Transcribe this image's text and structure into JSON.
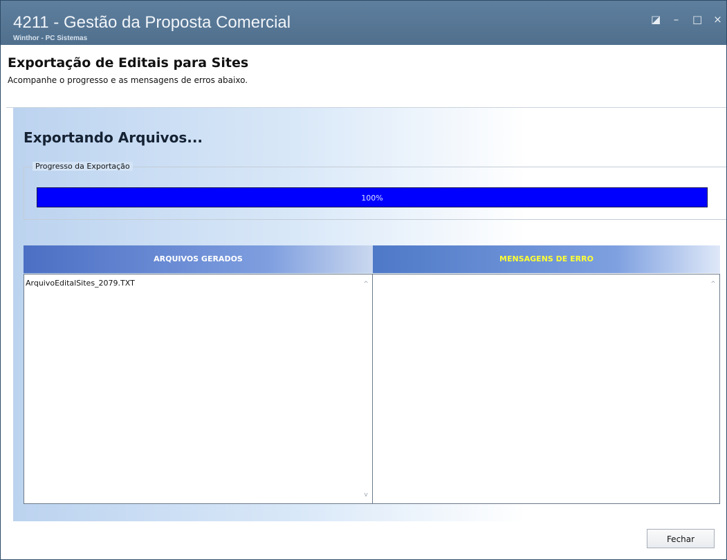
{
  "window": {
    "title": "4211 - Gestão da Proposta Comercial",
    "subtitle": "Winthor - PC Sistemas",
    "buttons": [
      "restore-icon",
      "minimize-icon",
      "maximize-icon",
      "close-icon"
    ]
  },
  "header": {
    "title": "Exportação de Editais para Sites",
    "description": "Acompanhe o progresso e as mensagens de erros abaixo."
  },
  "main": {
    "heading": "Exportando Arquivos...",
    "progress_group_label": "Progresso da Exportação",
    "progress": {
      "value_percent": 100,
      "label": "100%"
    }
  },
  "panels": {
    "generated_files": {
      "title": "ARQUIVOS GERADOS",
      "items": [
        "ArquivoEditalSites_2079.TXT"
      ]
    },
    "error_messages": {
      "title": "MENSAGENS DE ERRO",
      "items": []
    }
  },
  "footer": {
    "close_button": "Fechar"
  },
  "colors": {
    "progress": "#0000ff",
    "error_header_text": "#ffff33"
  }
}
